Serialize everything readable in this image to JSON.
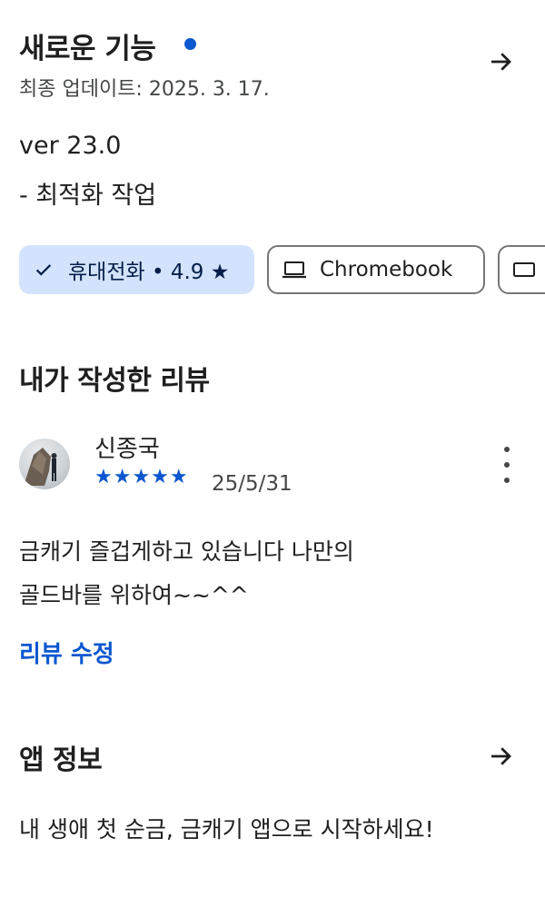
{
  "whats_new": {
    "title": "새로운 기능",
    "updated": "최종 업데이트: 2025. 3. 17.",
    "version": "ver 23.0",
    "notes": "- 최적화 작업"
  },
  "device_chips": [
    {
      "label": "휴대전화 • 4.9 ★",
      "selected": true,
      "icon": "check-icon"
    },
    {
      "label": "Chromebook",
      "selected": false,
      "icon": "laptop-icon"
    },
    {
      "label": "",
      "selected": false,
      "icon": "tablet-icon"
    }
  ],
  "my_review": {
    "heading": "내가 작성한 리뷰",
    "author": "신종국",
    "rating": 5,
    "stars_text": "★★★★★",
    "date": "25/5/31",
    "text_line1": "금캐기 즐겁게하고 있습니다 나만의",
    "text_line2": "골드바를 위하여~~^^",
    "edit_label": "리뷰 수정"
  },
  "app_info": {
    "heading": "앱 정보",
    "description": "내 생애 첫 순금, 금캐기 앱으로 시작하세요!"
  },
  "colors": {
    "accent": "#0b57d0",
    "chip_selected_bg": "#d3e3fd",
    "text_primary": "#1f1f1f",
    "text_secondary": "#444746"
  }
}
